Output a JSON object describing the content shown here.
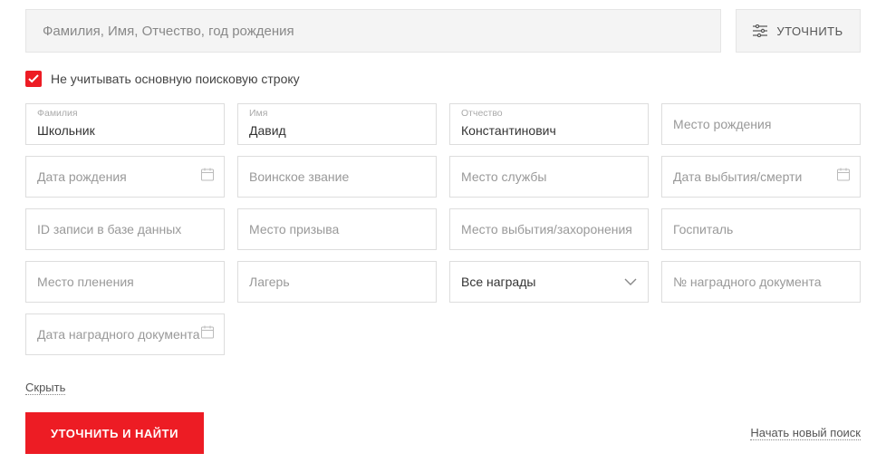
{
  "search": {
    "main_placeholder": "Фамилия, Имя, Отчество, год рождения",
    "refine_label": "УТОЧНИТЬ"
  },
  "checkbox": {
    "checked": true,
    "label": "Не учитывать основную поисковую строку"
  },
  "fields": {
    "lastname": {
      "label": "Фамилия",
      "value": "Школьник"
    },
    "firstname": {
      "label": "Имя",
      "value": "Давид"
    },
    "patronymic": {
      "label": "Отчество",
      "value": "Константинович"
    },
    "birthplace": {
      "placeholder": "Место рождения"
    },
    "birthdate": {
      "placeholder": "Дата рождения"
    },
    "rank": {
      "placeholder": "Воинское звание"
    },
    "serviceplace": {
      "placeholder": "Место службы"
    },
    "departuredate": {
      "placeholder": "Дата выбытия/смерти"
    },
    "recordid": {
      "placeholder": "ID записи в базе данных"
    },
    "draftplace": {
      "placeholder": "Место призыва"
    },
    "burialplace": {
      "placeholder": "Место выбытия/захоронения"
    },
    "hospital": {
      "placeholder": "Госпиталь"
    },
    "captureplace": {
      "placeholder": "Место пленения"
    },
    "camp": {
      "placeholder": "Лагерь"
    },
    "awards_select": {
      "label": "Все награды"
    },
    "awarddocnum": {
      "placeholder": "№ наградного документа"
    },
    "awarddocdate": {
      "placeholder": "Дата наградного документа"
    }
  },
  "actions": {
    "hide": "Скрыть",
    "submit": "УТОЧНИТЬ И НАЙТИ",
    "new_search": "Начать новый поиск"
  }
}
